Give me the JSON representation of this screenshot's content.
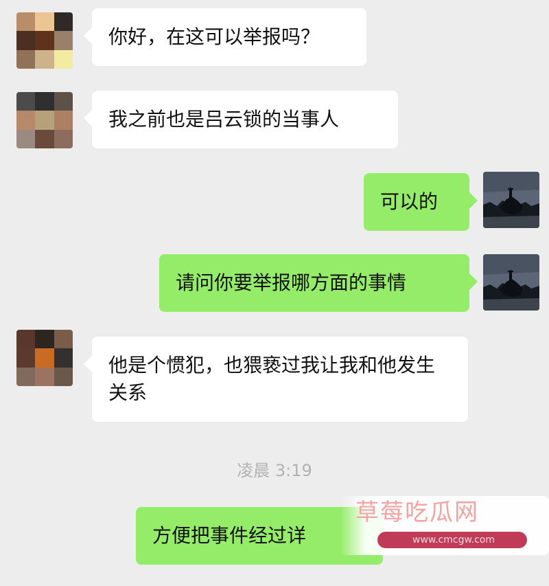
{
  "messages": [
    {
      "side": "left",
      "text": "你好，在这可以举报吗？"
    },
    {
      "side": "left",
      "text": "我之前也是吕云锁的当事人"
    },
    {
      "side": "right",
      "text": "可以的"
    },
    {
      "side": "right",
      "text": "请问你要举报哪方面的事情"
    },
    {
      "side": "left",
      "text": "他是个惯犯，也猥亵过我让我和他发生关系"
    },
    {
      "side": "right",
      "text": "方便把事件经过详"
    }
  ],
  "time_separator": "凌晨 3:19",
  "watermark": {
    "title": "草莓吃瓜网",
    "url": "www.cmcgw.com"
  },
  "colors": {
    "background": "#ededed",
    "bubble_left": "#ffffff",
    "bubble_right": "#95ec69",
    "time_text": "#b2b2b2"
  }
}
